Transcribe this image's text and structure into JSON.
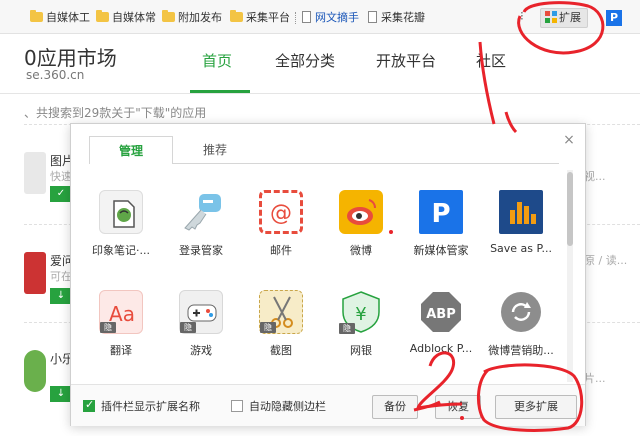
{
  "bookmarks": [
    {
      "label": "自媒体工",
      "type": "folder"
    },
    {
      "label": "自媒体常",
      "type": "folder"
    },
    {
      "label": "附加发布",
      "type": "folder"
    },
    {
      "label": "采集平台",
      "type": "folder"
    },
    {
      "label": "网文摘手",
      "type": "page"
    },
    {
      "label": "采集花瓣",
      "type": "page"
    }
  ],
  "toolbar": {
    "more": "⁝",
    "extensions_label": "扩展",
    "p_label": "P"
  },
  "site": {
    "title": "0应用市场",
    "url": "se.360.cn"
  },
  "nav": [
    "首页",
    "全部分类",
    "开放平台",
    "社区"
  ],
  "search_result": "、共搜索到29款关于\"下载\"的应用",
  "bg_items": [
    {
      "title": "图片",
      "sub": "快速",
      "btn": "✓",
      "right": "视..."
    },
    {
      "title": "爱问",
      "sub": "可在",
      "btn": "↓",
      "right": "原 / 读..."
    },
    {
      "title": "小乐",
      "sub": "",
      "btn": "↓",
      "right": "片..."
    }
  ],
  "popup": {
    "close": "×",
    "tabs": [
      "管理",
      "推荐"
    ],
    "extensions": [
      {
        "label": "印象笔记·...",
        "icon": "evernote-icon",
        "hidden": false
      },
      {
        "label": "登录管家",
        "icon": "key-icon",
        "hidden": false
      },
      {
        "label": "邮件",
        "icon": "mail-icon",
        "hidden": false
      },
      {
        "label": "微博",
        "icon": "weibo-icon",
        "hidden": false
      },
      {
        "label": "新媒体管家",
        "icon": "p-logo-icon",
        "hidden": false
      },
      {
        "label": "Save as P...",
        "icon": "save-chart-icon",
        "hidden": false
      },
      {
        "label": "翻译",
        "icon": "translate-icon",
        "hidden": true
      },
      {
        "label": "游戏",
        "icon": "gamepad-icon",
        "hidden": true
      },
      {
        "label": "截图",
        "icon": "scissors-icon",
        "hidden": true
      },
      {
        "label": "网银",
        "icon": "shield-yen-icon",
        "hidden": true
      },
      {
        "label": "Adblock P...",
        "icon": "abp-icon",
        "hidden": false
      },
      {
        "label": "微博营销助...",
        "icon": "refresh-icon",
        "hidden": false
      }
    ],
    "hidden_tag": "隐",
    "footer": {
      "show_names": "插件栏显示扩展名称",
      "auto_hide": "自动隐藏侧边栏",
      "backup": "备份",
      "restore": "恢复",
      "more": "更多扩展"
    }
  },
  "annotations": {
    "one": "1",
    "two": "2"
  },
  "colors": {
    "accent": "#27a23f",
    "annotation": "#e8232b"
  }
}
